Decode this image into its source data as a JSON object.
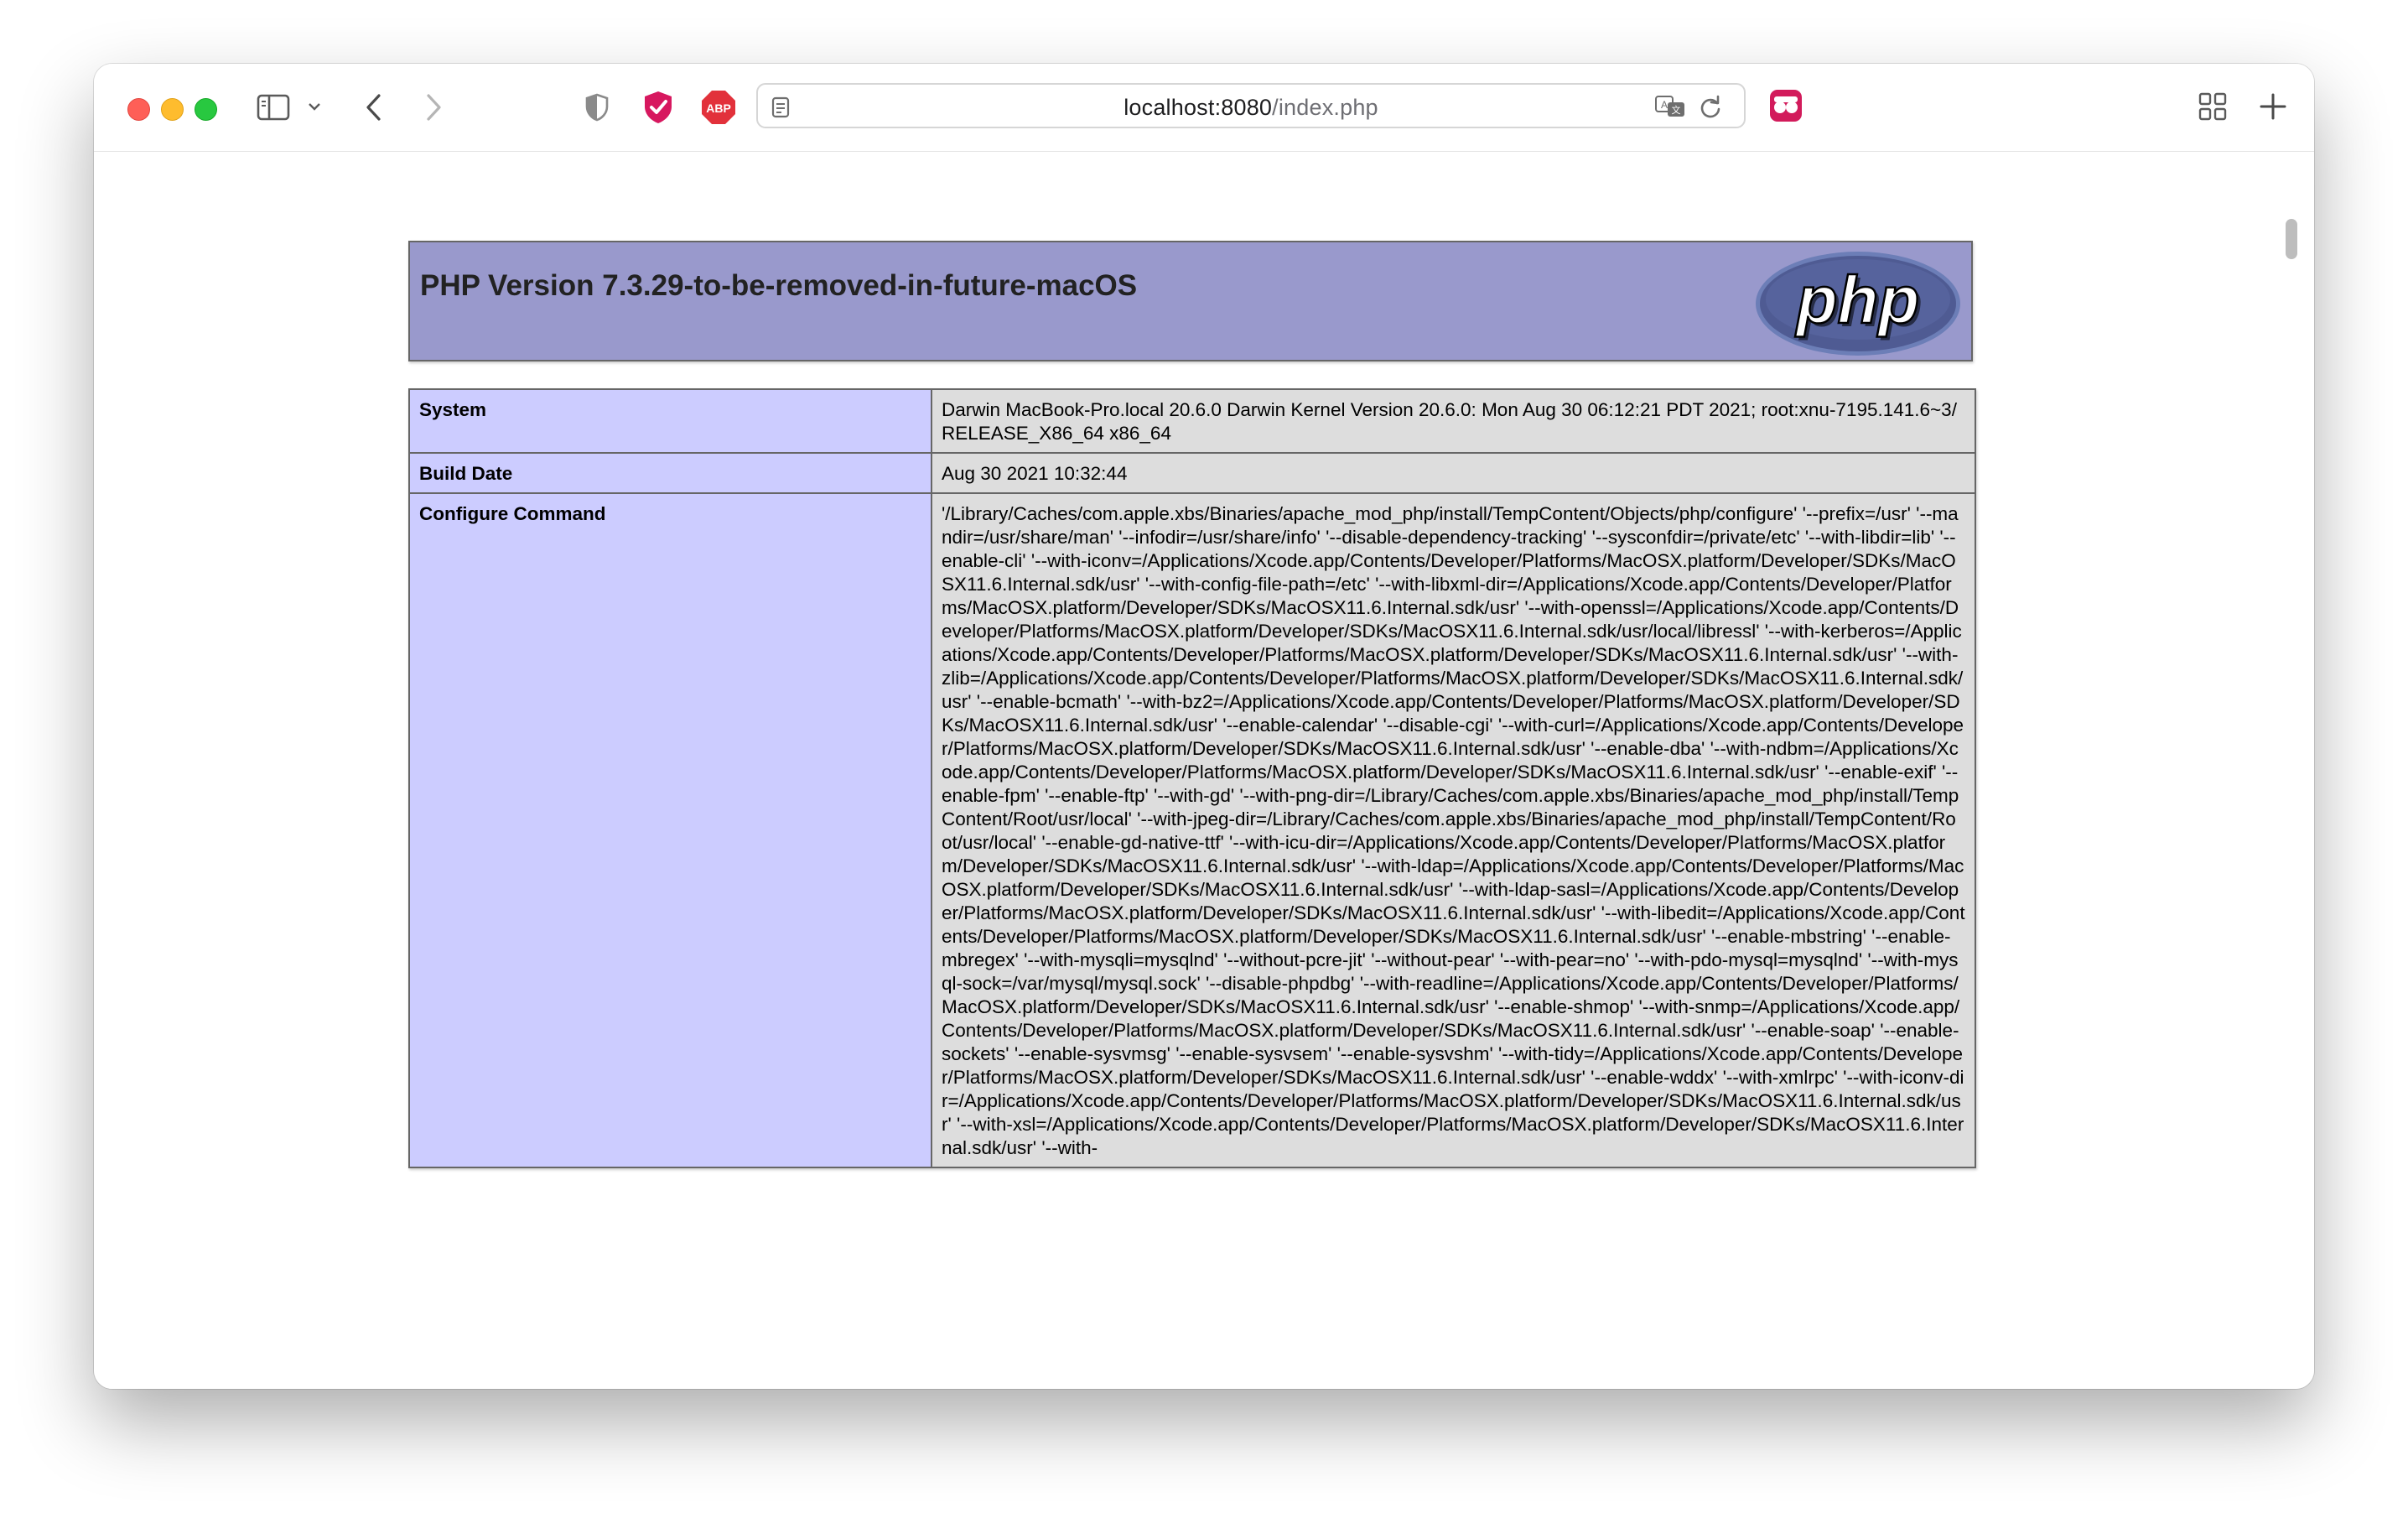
{
  "browser": {
    "url_host": "localhost:8080",
    "url_path": "/index.php",
    "icons": [
      "sidebar-icon",
      "chevron-down-icon",
      "back-icon",
      "forward-icon",
      "privacy-shield-icon",
      "shield-check-extension-icon",
      "abp-extension-icon",
      "page-icon",
      "translate-icon",
      "reload-icon",
      "extension-icon",
      "tab-overview-icon",
      "new-tab-icon"
    ],
    "abp_label": "ABP"
  },
  "phpinfo": {
    "title": "PHP Version 7.3.29-to-be-removed-in-future-macOS",
    "logo_text": "php",
    "header_color": "#9999cc",
    "key_color": "#ccccff",
    "value_color": "#dddddd",
    "rows": [
      {
        "key": "System",
        "value": "Darwin MacBook-Pro.local 20.6.0 Darwin Kernel Version 20.6.0: Mon Aug 30 06:12:21 PDT 2021; root:xnu-7195.141.6~3/RELEASE_X86_64 x86_64"
      },
      {
        "key": "Build Date",
        "value": "Aug 30 2021 10:32:44"
      },
      {
        "key": "Configure Command",
        "value": "'/Library/Caches/com.apple.xbs/Binaries/apache_mod_php/install/TempContent/Objects/php/configure' '--prefix=/usr' '--mandir=/usr/share/man' '--infodir=/usr/share/info' '--disable-dependency-tracking' '--sysconfdir=/private/etc' '--with-libdir=lib' '--enable-cli' '--with-iconv=/Applications/Xcode.app/Contents/Developer/Platforms/MacOSX.platform/Developer/SDKs/MacOSX11.6.Internal.sdk/usr' '--with-config-file-path=/etc' '--with-libxml-dir=/Applications/Xcode.app/Contents/Developer/Platforms/MacOSX.platform/Developer/SDKs/MacOSX11.6.Internal.sdk/usr' '--with-openssl=/Applications/Xcode.app/Contents/Developer/Platforms/MacOSX.platform/Developer/SDKs/MacOSX11.6.Internal.sdk/usr/local/libressl' '--with-kerberos=/Applications/Xcode.app/Contents/Developer/Platforms/MacOSX.platform/Developer/SDKs/MacOSX11.6.Internal.sdk/usr' '--with-zlib=/Applications/Xcode.app/Contents/Developer/Platforms/MacOSX.platform/Developer/SDKs/MacOSX11.6.Internal.sdk/usr' '--enable-bcmath' '--with-bz2=/Applications/Xcode.app/Contents/Developer/Platforms/MacOSX.platform/Developer/SDKs/MacOSX11.6.Internal.sdk/usr' '--enable-calendar' '--disable-cgi' '--with-curl=/Applications/Xcode.app/Contents/Developer/Platforms/MacOSX.platform/Developer/SDKs/MacOSX11.6.Internal.sdk/usr' '--enable-dba' '--with-ndbm=/Applications/Xcode.app/Contents/Developer/Platforms/MacOSX.platform/Developer/SDKs/MacOSX11.6.Internal.sdk/usr' '--enable-exif' '--enable-fpm' '--enable-ftp' '--with-gd' '--with-png-dir=/Library/Caches/com.apple.xbs/Binaries/apache_mod_php/install/TempContent/Root/usr/local' '--with-jpeg-dir=/Library/Caches/com.apple.xbs/Binaries/apache_mod_php/install/TempContent/Root/usr/local' '--enable-gd-native-ttf' '--with-icu-dir=/Applications/Xcode.app/Contents/Developer/Platforms/MacOSX.platform/Developer/SDKs/MacOSX11.6.Internal.sdk/usr' '--with-ldap=/Applications/Xcode.app/Contents/Developer/Platforms/MacOSX.platform/Developer/SDKs/MacOSX11.6.Internal.sdk/usr' '--with-ldap-sasl=/Applications/Xcode.app/Contents/Developer/Platforms/MacOSX.platform/Developer/SDKs/MacOSX11.6.Internal.sdk/usr' '--with-libedit=/Applications/Xcode.app/Contents/Developer/Platforms/MacOSX.platform/Developer/SDKs/MacOSX11.6.Internal.sdk/usr' '--enable-mbstring' '--enable-mbregex' '--with-mysqli=mysqlnd' '--without-pcre-jit' '--without-pear' '--with-pear=no' '--with-pdo-mysql=mysqlnd' '--with-mysql-sock=/var/mysql/mysql.sock' '--disable-phpdbg' '--with-readline=/Applications/Xcode.app/Contents/Developer/Platforms/MacOSX.platform/Developer/SDKs/MacOSX11.6.Internal.sdk/usr' '--enable-shmop' '--with-snmp=/Applications/Xcode.app/Contents/Developer/Platforms/MacOSX.platform/Developer/SDKs/MacOSX11.6.Internal.sdk/usr' '--enable-soap' '--enable-sockets' '--enable-sysvmsg' '--enable-sysvsem' '--enable-sysvshm' '--with-tidy=/Applications/Xcode.app/Contents/Developer/Platforms/MacOSX.platform/Developer/SDKs/MacOSX11.6.Internal.sdk/usr' '--enable-wddx' '--with-xmlrpc' '--with-iconv-dir=/Applications/Xcode.app/Contents/Developer/Platforms/MacOSX.platform/Developer/SDKs/MacOSX11.6.Internal.sdk/usr' '--with-xsl=/Applications/Xcode.app/Contents/Developer/Platforms/MacOSX.platform/Developer/SDKs/MacOSX11.6.Internal.sdk/usr' '--with-"
      }
    ]
  }
}
